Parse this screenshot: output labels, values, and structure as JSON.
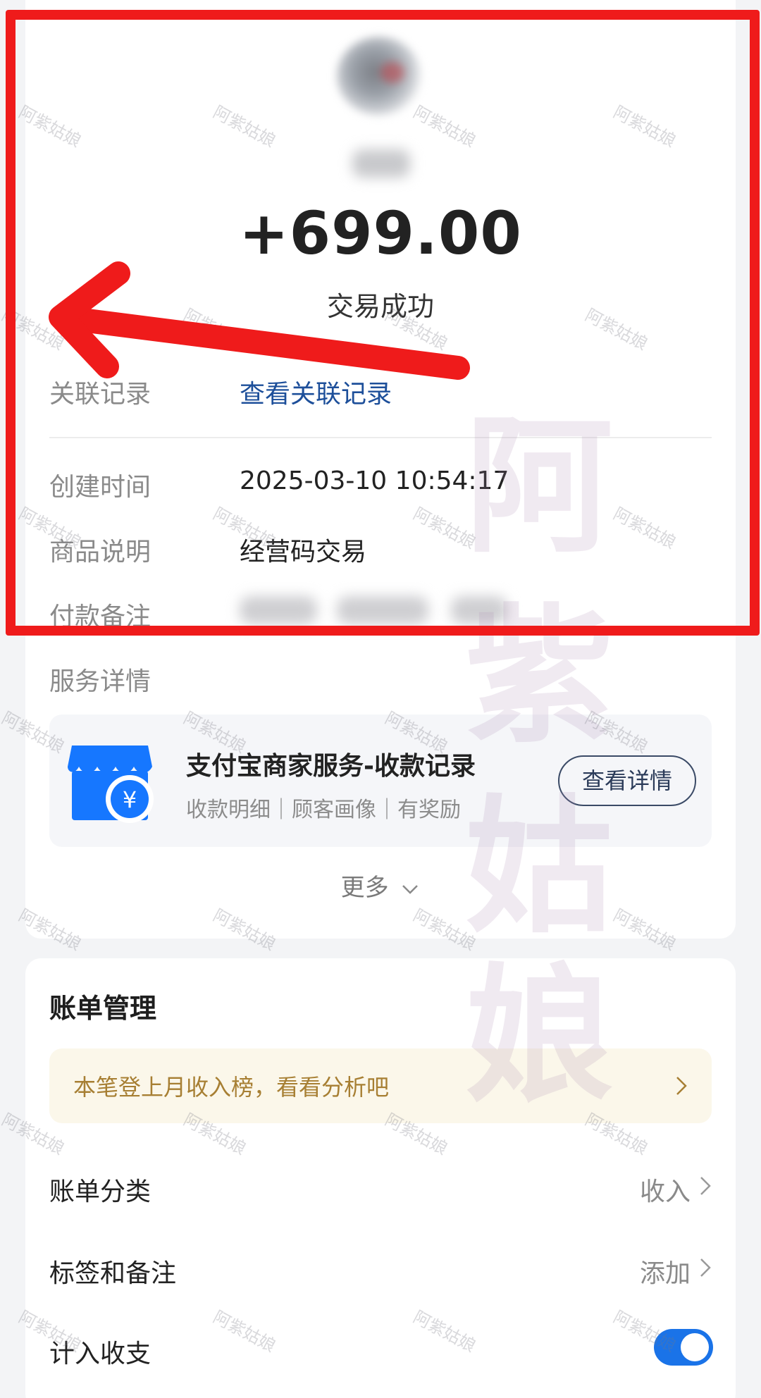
{
  "transaction": {
    "amount": "+699.00",
    "status": "交易成功"
  },
  "details": {
    "related_label": "关联记录",
    "related_link": "查看关联记录",
    "created_label": "创建时间",
    "created_value": "2025-03-10 10:54:17",
    "goods_label": "商品说明",
    "goods_value": "经营码交易",
    "remark_label": "付款备注",
    "service_label": "服务详情"
  },
  "service": {
    "title": "支付宝商家服务-收款记录",
    "subtitle": "收款明细｜顾客画像｜有奖励",
    "button": "查看详情",
    "icon": "store-yuan-icon"
  },
  "more": "更多",
  "bill": {
    "title": "账单管理",
    "banner": "本笔登上月收入榜，看看分析吧",
    "items": [
      {
        "label": "账单分类",
        "value": "收入"
      },
      {
        "label": "标签和备注",
        "value": "添加"
      },
      {
        "label": "计入收支",
        "toggle": true
      }
    ]
  },
  "watermark": {
    "small": "阿紫姑娘",
    "big": [
      "阿",
      "紫",
      "姑",
      "娘"
    ]
  },
  "colors": {
    "link": "#1d4f9a",
    "annotation": "#ef1b1b",
    "toggle": "#1a73e8",
    "banner_text": "#a77f33"
  }
}
